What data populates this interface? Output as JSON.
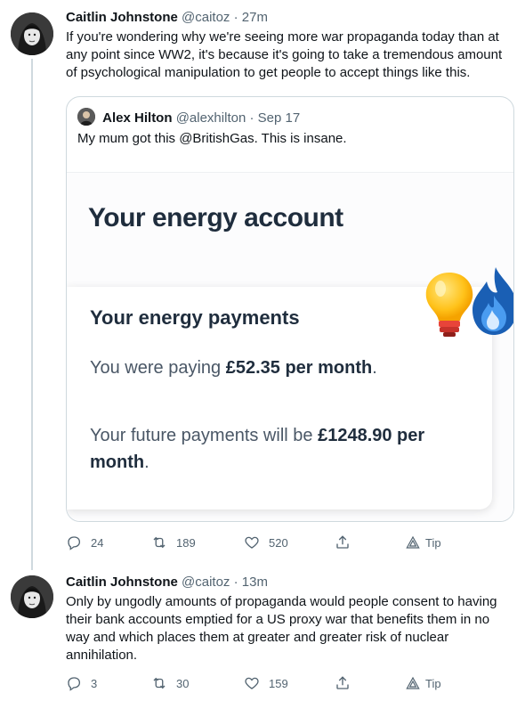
{
  "tweets": [
    {
      "author_name": "Caitlin Johnstone",
      "handle": "@caitoz",
      "time": "27m",
      "text": "If you're wondering why we're seeing more war propaganda today than at any point since WW2, it's because it's going to take a tremendous amount of psychological manipulation to get people to accept things like this.",
      "quote": {
        "author_name": "Alex Hilton",
        "handle": "@alexhilton",
        "date": "Sep 17",
        "text": "My mum got this @BritishGas. This is insane.",
        "media": {
          "title": "Your energy account",
          "card_title": "Your energy payments",
          "line1_prefix": "You were paying",
          "line1_amount": "£52.35 per month",
          "line2_prefix": "Your future payments will be",
          "line2_amount": "£1248.90 per month"
        }
      },
      "counts": {
        "replies": "24",
        "retweets": "189",
        "likes": "520",
        "tip": "Tip"
      }
    },
    {
      "author_name": "Caitlin Johnstone",
      "handle": "@caitoz",
      "time": "13m",
      "text": "Only by ungodly amounts of propaganda would people consent to having their bank accounts emptied for a US proxy war that benefits them in no way and which places them at greater and greater risk of nuclear annihilation.",
      "counts": {
        "replies": "3",
        "retweets": "30",
        "likes": "159",
        "tip": "Tip"
      }
    }
  ],
  "separator": " · ",
  "period": ".",
  "colors": {
    "text": "#0f1419",
    "secondary": "#536471",
    "border": "#cfd9de"
  }
}
